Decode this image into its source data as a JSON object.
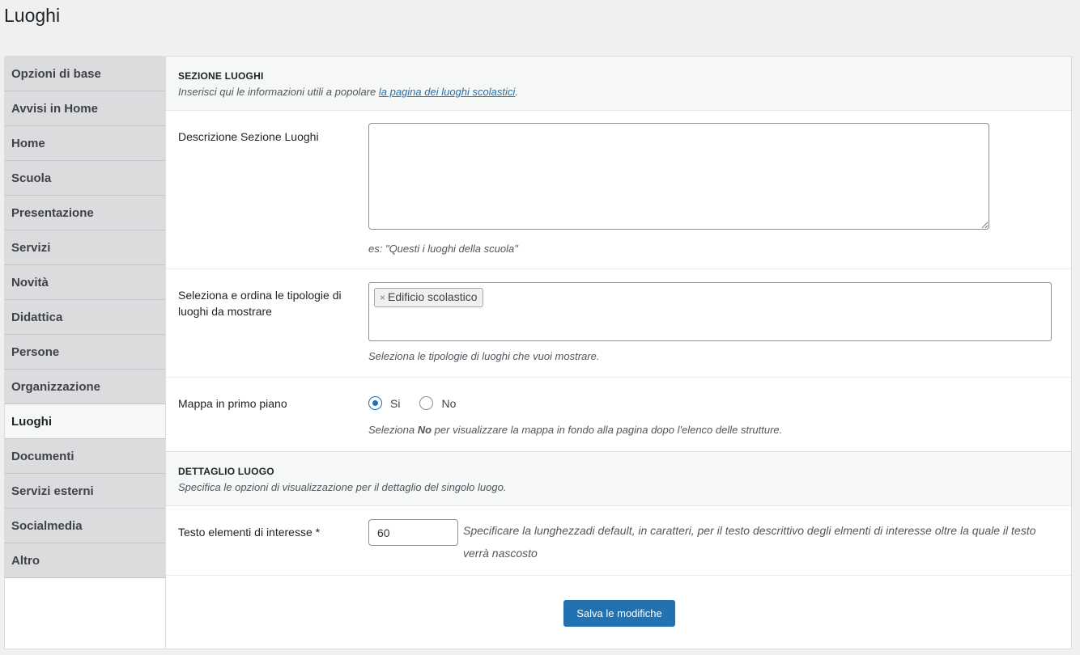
{
  "page": {
    "title": "Luoghi"
  },
  "sidebar": {
    "items": [
      {
        "label": "Opzioni di base"
      },
      {
        "label": "Avvisi in Home"
      },
      {
        "label": "Home"
      },
      {
        "label": "Scuola"
      },
      {
        "label": "Presentazione"
      },
      {
        "label": "Servizi"
      },
      {
        "label": "Novità"
      },
      {
        "label": "Didattica"
      },
      {
        "label": "Persone"
      },
      {
        "label": "Organizzazione"
      },
      {
        "label": "Luoghi",
        "active": true
      },
      {
        "label": "Documenti"
      },
      {
        "label": "Servizi esterni"
      },
      {
        "label": "Socialmedia"
      },
      {
        "label": "Altro"
      }
    ]
  },
  "section1": {
    "title": "SEZIONE LUOGHI",
    "desc_prefix": "Inserisci qui le informazioni utili a popolare ",
    "desc_link": "la pagina dei luoghi scolastici",
    "desc_suffix": "."
  },
  "descrizione": {
    "label": "Descrizione Sezione Luoghi",
    "value": "",
    "help": "es: \"Questi i luoghi della scuola\""
  },
  "tipologie": {
    "label": "Seleziona e ordina le tipologie di luoghi da mostrare",
    "selected": [
      "Edificio scolastico"
    ],
    "remove_glyph": "×",
    "help": "Seleziona le tipologie di luoghi che vuoi mostrare."
  },
  "mappa": {
    "label": "Mappa in primo piano",
    "options": [
      {
        "label": "Si",
        "checked": true
      },
      {
        "label": "No",
        "checked": false
      }
    ],
    "help_prefix": "Seleziona ",
    "help_bold": "No",
    "help_suffix": " per visualizzare la mappa in fondo alla pagina dopo l'elenco delle strutture."
  },
  "section2": {
    "title": "DETTAGLIO LUOGO",
    "desc": "Specifica le opzioni di visualizzazione per il dettaglio del singolo luogo."
  },
  "testo_elementi": {
    "label": "Testo elementi di interesse *",
    "value": "60",
    "help": "Specificare la lunghezzadi default, in caratteri, per il testo descrittivo degli elmenti di interesse oltre la quale il testo verrà nascosto"
  },
  "actions": {
    "save_label": "Salva le modifiche"
  },
  "colors": {
    "accent": "#2271b1",
    "sidebar_bg": "#dcdcde",
    "page_bg": "#f0f0f1"
  }
}
